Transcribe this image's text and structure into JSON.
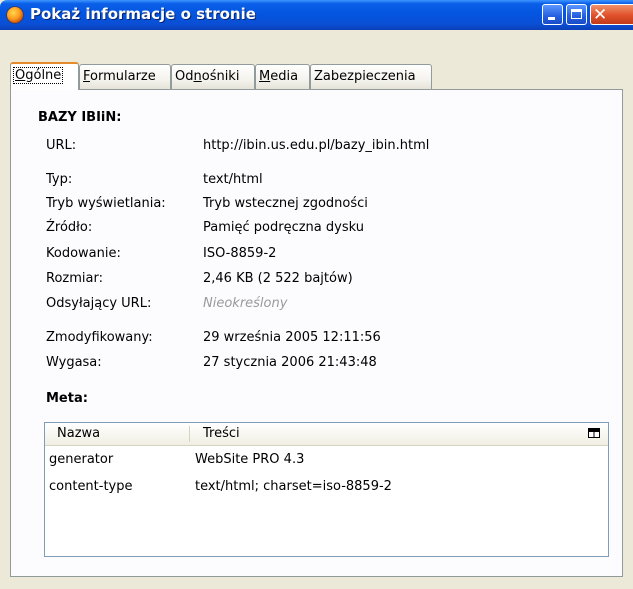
{
  "window": {
    "title": "Pokaż informacje o stronie",
    "title_icon": "firefox-icon",
    "controls": [
      "minimize",
      "maximize",
      "close"
    ]
  },
  "tabs": [
    {
      "label_ul": "O",
      "label_rest": "gólne",
      "active": true
    },
    {
      "label_ul": "F",
      "label_rest": "ormularze",
      "active": false
    },
    {
      "label_pre": "Od",
      "label_ul": "n",
      "label_rest": "ośniki",
      "active": false
    },
    {
      "label_ul": "M",
      "label_rest": "edia",
      "active": false
    },
    {
      "label_pre": "",
      "label_ul": "",
      "label_rest": "Zabezpieczenia",
      "active": false
    }
  ],
  "general": {
    "site_title": "BAZY IBIiN:",
    "url_label": "URL:",
    "url_value": "http://ibin.us.edu.pl/bazy_ibin.html",
    "fields": [
      {
        "label": "Typ:",
        "value": "text/html"
      },
      {
        "label": "Tryb wyświetlania:",
        "value": "Tryb wstecznej zgodności"
      },
      {
        "label": "Źródło:",
        "value": "Pamięć podręczna dysku"
      },
      {
        "label": "Kodowanie:",
        "value": "ISO-8859-2"
      },
      {
        "label": "Rozmiar:",
        "value": "2,46 KB (2 522 bajtów)"
      },
      {
        "label": "Odsyłający URL:",
        "value": "Nieokreślony"
      }
    ],
    "dates": [
      {
        "label": "Zmodyfikowany:",
        "value": "29 września 2005 12:11:56"
      },
      {
        "label": "Wygasa:",
        "value": "27 stycznia 2006 21:43:48"
      }
    ]
  },
  "meta": {
    "title": "Meta:",
    "columns": [
      "Nazwa",
      "Treści"
    ],
    "rows": [
      {
        "name": "generator",
        "content": "WebSite PRO 4.3"
      },
      {
        "name": "content-type",
        "content": "text/html; charset=iso-8859-2"
      }
    ]
  }
}
